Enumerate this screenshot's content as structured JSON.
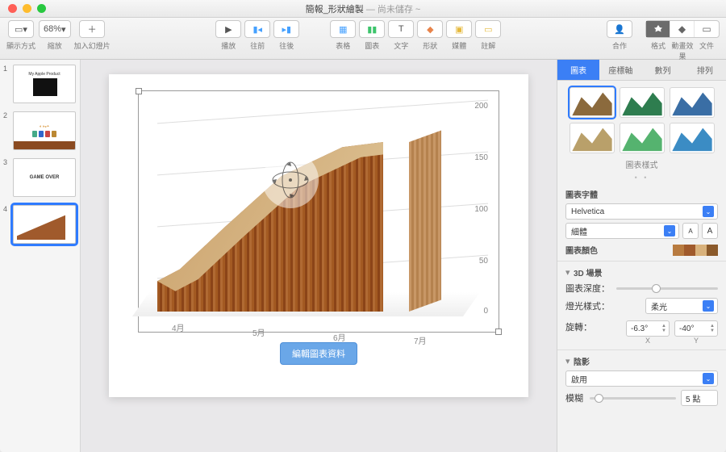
{
  "window": {
    "title": "簡報_形狀繪製",
    "subtitle": "— 尚未儲存 ~"
  },
  "toolbar": {
    "view_label": "顯示方式",
    "zoom_text": "68%",
    "zoom_label": "縮放",
    "add_slide_label": "加入幻燈片",
    "play_label": "播放",
    "prepres_label": "往前",
    "nextpres_label": "往後",
    "table_label": "表格",
    "chart_label": "圖表",
    "text_label": "文字",
    "shape_label": "形狀",
    "media_label": "媒體",
    "comment_label": "註解",
    "collab_label": "合作",
    "inspector_tabs": {
      "format": "格式",
      "animate": "動畫效果",
      "document": "文件"
    }
  },
  "thumbs": [
    {
      "num": "1",
      "caption": "My Apple Product"
    },
    {
      "num": "2",
      "caption": ""
    },
    {
      "num": "3",
      "caption": "GAME OVER"
    },
    {
      "num": "4",
      "caption": ""
    }
  ],
  "canvas": {
    "edit_data_btn": "編輯圖表資料",
    "y_ticks": [
      "200",
      "150",
      "100",
      "50",
      "0"
    ],
    "x_ticks": [
      "4月",
      "5月",
      "6月",
      "7月"
    ]
  },
  "chart_data": {
    "type": "area",
    "categories": [
      "4月",
      "5月",
      "6月",
      "7月"
    ],
    "values": [
      30,
      70,
      140,
      190
    ],
    "ylim": [
      0,
      200
    ],
    "xlabel": "",
    "ylabel": "",
    "style": "3D wood texture"
  },
  "inspector": {
    "tabs": [
      "圖表",
      "座標軸",
      "數列",
      "排列"
    ],
    "style_label": "圖表樣式",
    "font_section": "圖表字體",
    "font_family": "Helvetica",
    "font_weight": "細體",
    "size_small": "A",
    "size_large": "A",
    "color_section": "圖表顏色",
    "swatch_colors": [
      "#b87b40",
      "#a05a2c",
      "#d9b27c",
      "#8b5a2b"
    ],
    "scene_section": "3D 場景",
    "depth_label": "圖表深度：",
    "light_label": "燈光樣式：",
    "light_value": "柔光",
    "rotate_label": "旋轉：",
    "rotate_x": "-6.3°",
    "rotate_y": "-40°",
    "axis_x": "X",
    "axis_y": "Y",
    "shadow_section": "陰影",
    "shadow_enable": "啟用",
    "blur_label": "模糊",
    "blur_value": "5 點"
  }
}
